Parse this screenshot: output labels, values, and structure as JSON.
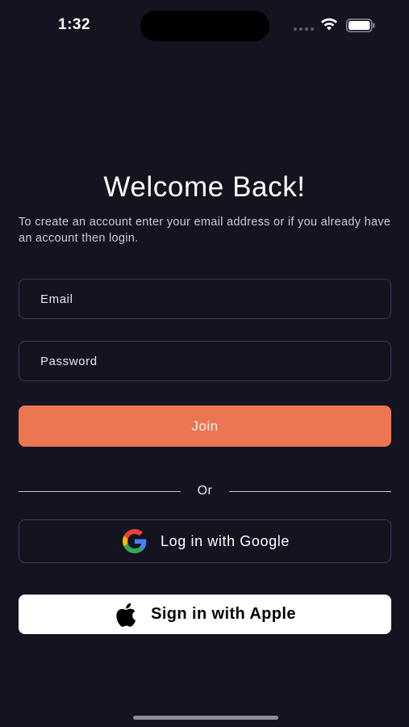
{
  "status_bar": {
    "time": "1:32"
  },
  "header": {
    "title": "Welcome Back!",
    "subtitle": "To create an account enter your email address or if you already have an account then login."
  },
  "form": {
    "email_placeholder": "Email",
    "password_placeholder": "Password",
    "join_label": "Join"
  },
  "divider": {
    "label": "Or"
  },
  "social": {
    "google_label": "Log in with Google",
    "google_icon": "google-logo",
    "apple_label": "Sign in with Apple",
    "apple_icon": "apple-logo"
  },
  "colors": {
    "background": "#13141f",
    "accent": "#ec7552",
    "field_border": "#3a3b5e"
  }
}
